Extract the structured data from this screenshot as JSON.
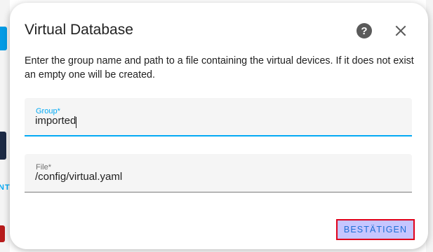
{
  "dialog": {
    "title": "Virtual Database",
    "help_icon": "help-circle-icon",
    "close_icon": "close-icon",
    "description": "Enter the group name and path to a file containing the virtual devices. If it does not exist an empty one will be created.",
    "fields": {
      "group": {
        "label": "Group*",
        "value": "imported"
      },
      "file": {
        "label": "File*",
        "value": "/config/virtual.yaml"
      }
    },
    "confirm_label": "BESTÄTIGEN"
  },
  "background": {
    "strip_text": "NT"
  },
  "colors": {
    "accent": "#03a9f4",
    "confirm_text": "#1f6fd6",
    "confirm_highlight_bg": "#c6c6ff",
    "confirm_highlight_border": "#e0001a"
  }
}
